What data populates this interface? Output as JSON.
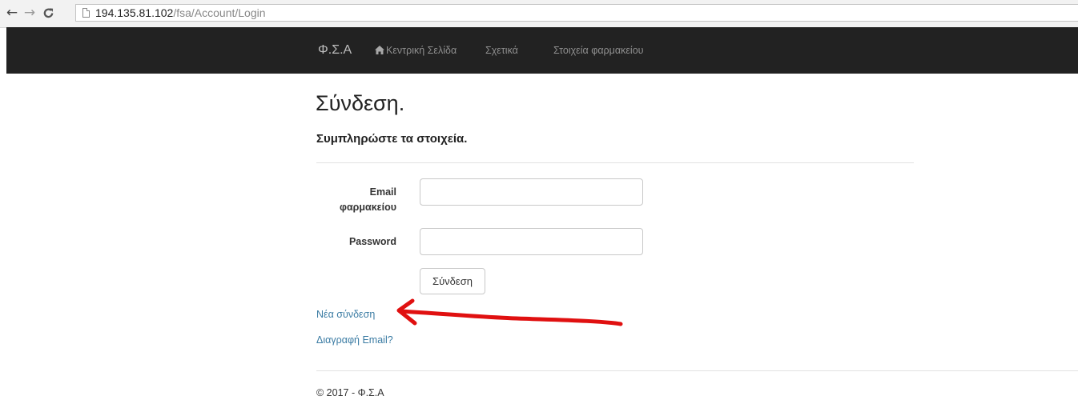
{
  "browser": {
    "url_host": "194.135.81.102",
    "url_path": "/fsa/Account/Login"
  },
  "navbar": {
    "brand": "Φ.Σ.Α",
    "links": [
      {
        "label": "Κεντρική Σελίδα",
        "icon": "home-icon"
      },
      {
        "label": "Σχετικά"
      },
      {
        "label": "Στοιχεία φαρμακείου"
      }
    ]
  },
  "main": {
    "title": "Σύνδεση.",
    "subtitle": "Συμπληρώστε τα στοιχεία.",
    "email_label_line1": "Email",
    "email_label_line2": "φαρμακείου",
    "email_value": "",
    "password_label": "Password",
    "password_value": "",
    "submit_label": "Σύνδεση",
    "new_link": "Νέα σύνδεση",
    "delete_link": "Διαγραφή Email?"
  },
  "annotation": {
    "arrow_color": "#e01010"
  },
  "footer": {
    "text": "© 2017 - Φ.Σ.Α"
  }
}
